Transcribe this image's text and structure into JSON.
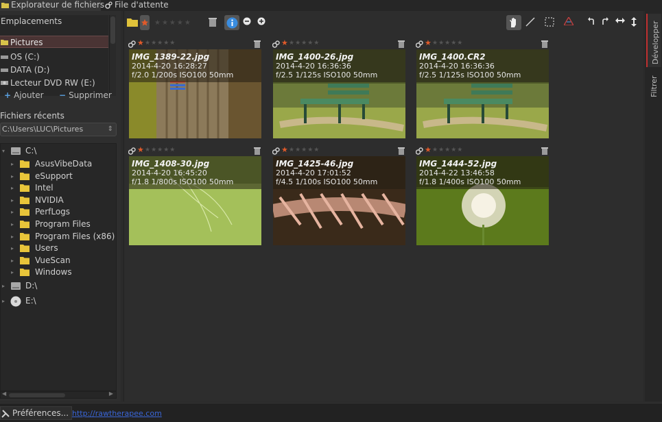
{
  "tabs": [
    {
      "label": "Explorateur de fichiers",
      "icon": "folder-icon",
      "active": true
    },
    {
      "label": "File d'attente",
      "icon": "gears-icon",
      "active": false
    }
  ],
  "places": {
    "header": "Emplacements",
    "items": [
      {
        "label": "Pictures",
        "icon": "folder-icon",
        "selected": true
      },
      {
        "label": "OS (C:)",
        "icon": "drive-icon"
      },
      {
        "label": "DATA (D:)",
        "icon": "drive-icon"
      },
      {
        "label": "Lecteur DVD RW (E:)",
        "icon": "dvd-icon"
      }
    ],
    "add_label": "Ajouter",
    "remove_label": "Supprimer"
  },
  "recent": {
    "label": "Fichiers récents",
    "path": "C:\\Users\\LUC\\Pictures"
  },
  "tree": {
    "root_c": "C:\\",
    "folders": [
      "AsusVibeData",
      "eSupport",
      "Intel",
      "NVIDIA",
      "PerfLogs",
      "Program Files",
      "Program Files (x86)",
      "Users",
      "VueScan",
      "Windows"
    ],
    "root_d": "D:\\",
    "root_e": "E:\\"
  },
  "toolbar": {
    "icons": [
      "folder-icon",
      "star-filter-icon",
      "trash-filter-icon",
      "info-icon",
      "zoom-out-icon",
      "zoom-in-icon",
      "hand-icon",
      "crop-line-icon",
      "selection-icon",
      "color-icon",
      "rotate-left-icon",
      "rotate-right-icon",
      "flip-horizontal-icon",
      "flip-vertical-icon"
    ]
  },
  "thumbnails": [
    {
      "filename": "IMG_1389-22.jpg",
      "date": "2014-4-20 16:28:27",
      "exif": "f/2.0 1/200s ISO100 50mm",
      "scene": "bark"
    },
    {
      "filename": "IMG_1400-26.jpg",
      "date": "2014-4-20 16:36:36",
      "exif": "f/2.5 1/125s ISO100 50mm",
      "scene": "bench"
    },
    {
      "filename": "IMG_1400.CR2",
      "date": "2014-4-20 16:36:36",
      "exif": "f/2.5 1/125s ISO100 50mm",
      "scene": "bench"
    },
    {
      "filename": "IMG_1408-30.jpg",
      "date": "2014-4-20 16:45:20",
      "exif": "f/1.8 1/800s ISO100 50mm",
      "scene": "grass"
    },
    {
      "filename": "IMG_1425-46.jpg",
      "date": "2014-4-20 17:01:52",
      "exif": "f/4.5 1/100s ISO100 50mm",
      "scene": "pink"
    },
    {
      "filename": "IMG_1444-52.jpg",
      "date": "2014-4-22 13:46:58",
      "exif": "f/1.8 1/400s ISO100 50mm",
      "scene": "dandelion"
    }
  ],
  "side_tabs": [
    "Développer",
    "Filtrer"
  ],
  "status": {
    "pref_label": "Préférences...",
    "link": "http://rawtherapee.com"
  },
  "colors": {
    "accent": "#c03030",
    "selected_place": "#4a3434",
    "link": "#3a66d8",
    "rating_star": "#e05a2a"
  }
}
